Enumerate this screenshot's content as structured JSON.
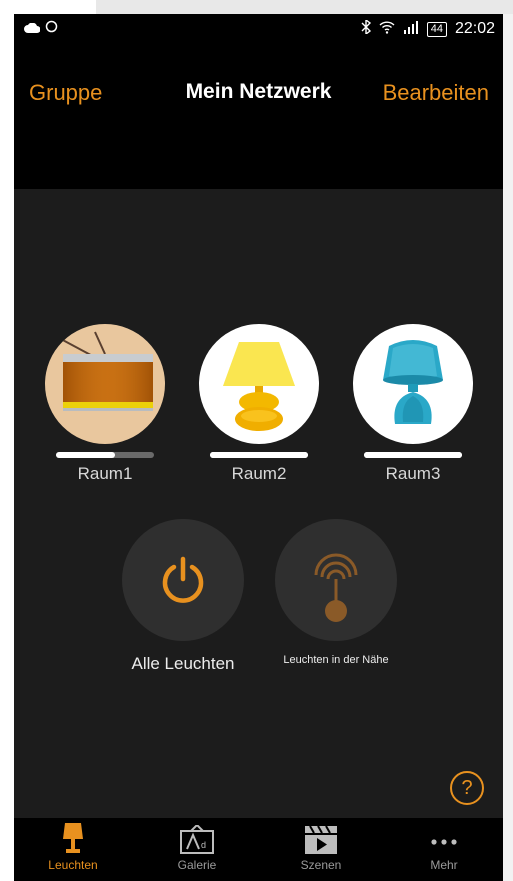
{
  "status": {
    "battery": "44",
    "time": "22:02"
  },
  "header": {
    "left_button": "Gruppe",
    "title": "Mein Netzwerk",
    "right_button": "Bearbeiten"
  },
  "rooms": [
    {
      "label": "Raum1",
      "brightness": 0.6
    },
    {
      "label": "Raum2",
      "brightness": 1.0
    },
    {
      "label": "Raum3",
      "brightness": 1.0
    }
  ],
  "actions": {
    "all_lights": "Alle Leuchten",
    "nearby_lights": "Leuchten in der Nähe"
  },
  "help": "?",
  "tabs": [
    {
      "label": "Leuchten",
      "icon": "lamp-icon",
      "active": true
    },
    {
      "label": "Galerie",
      "icon": "gallery-icon",
      "active": false
    },
    {
      "label": "Szenen",
      "icon": "scenes-icon",
      "active": false
    },
    {
      "label": "Mehr",
      "icon": "more-icon",
      "active": false
    }
  ],
  "colors": {
    "accent": "#e8911f",
    "background": "#1c1c1c",
    "bar": "#000000"
  }
}
